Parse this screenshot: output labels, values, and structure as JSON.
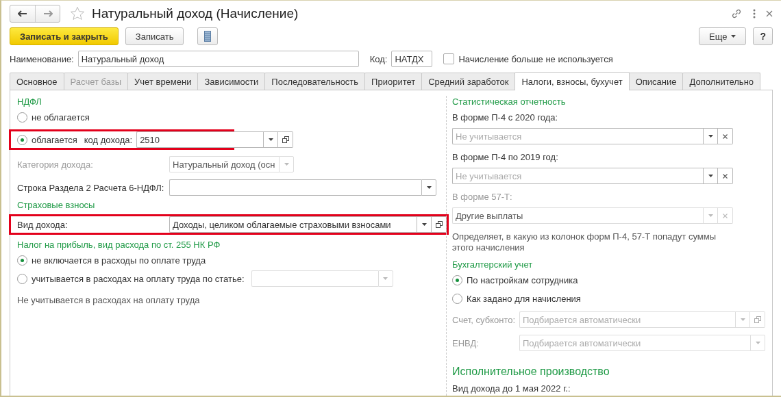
{
  "window": {
    "title": "Натуральный доход (Начисление)"
  },
  "toolbar": {
    "save_close": "Записать и закрыть",
    "save": "Записать",
    "more": "Еще",
    "help": "?"
  },
  "header": {
    "name_label": "Наименование:",
    "name_value": "Натуральный доход",
    "code_label": "Код:",
    "code_value": "НАТДХ",
    "unused": {
      "label": "Начисление больше не используется",
      "checked": false
    }
  },
  "tabs": [
    {
      "label": "Основное",
      "selected": false,
      "disabled": false
    },
    {
      "label": "Расчет базы",
      "selected": false,
      "disabled": true
    },
    {
      "label": "Учет времени",
      "selected": false,
      "disabled": false
    },
    {
      "label": "Зависимости",
      "selected": false,
      "disabled": false
    },
    {
      "label": "Последовательность",
      "selected": false,
      "disabled": false
    },
    {
      "label": "Приоритет",
      "selected": false,
      "disabled": false
    },
    {
      "label": "Средний заработок",
      "selected": false,
      "disabled": false
    },
    {
      "label": "Налоги, взносы, бухучет",
      "selected": true,
      "disabled": false
    },
    {
      "label": "Описание",
      "selected": false,
      "disabled": false
    },
    {
      "label": "Дополнительно",
      "selected": false,
      "disabled": false
    }
  ],
  "left": [
    {
      "kind": "section",
      "text": "НДФЛ"
    },
    {
      "kind": "radio",
      "label": "не облагается",
      "selected": false
    },
    {
      "kind": "radio",
      "label": "облагается",
      "selected": true,
      "highlighted": true,
      "field": {
        "label": "код дохода:",
        "value": "2510",
        "disabled": false,
        "dropdown": true,
        "open_button": true
      }
    },
    {
      "kind": "field",
      "label": "Категория дохода:",
      "value": "Натуральный доход (осн",
      "disabled": true,
      "dropdown": true
    },
    {
      "kind": "field",
      "label": "Строка Раздела 2 Расчета 6-НДФЛ:",
      "disabled": false,
      "dropdown": true
    },
    {
      "kind": "section",
      "text": "Страховые взносы"
    },
    {
      "kind": "field",
      "label": "Вид дохода:",
      "value": "Доходы, целиком облагаемые страховыми взносами",
      "disabled": false,
      "highlighted": true,
      "dropdown": true,
      "open_button": true
    },
    {
      "kind": "section",
      "text": "Налог на прибыль, вид расхода по ст. 255 НК РФ"
    },
    {
      "kind": "radio",
      "label": "не включается в расходы по оплате труда",
      "selected": true
    },
    {
      "kind": "radio",
      "label": "учитывается в расходах на оплату труда по статье:",
      "selected": false,
      "field": {
        "disabled": true,
        "dropdown": true
      }
    },
    {
      "kind": "note",
      "text": "Не учитывается в расходах на оплату труда"
    }
  ],
  "right": [
    {
      "kind": "section",
      "text": "Статистическая отчетность"
    },
    {
      "kind": "label",
      "text": "В форме П-4 с 2020 года:",
      "disabled": false
    },
    {
      "kind": "field",
      "placeholder": "Не учитывается",
      "disabled": false,
      "dropdown": true,
      "clear_button": true
    },
    {
      "kind": "label",
      "text": "В форме П-4 по 2019 год:",
      "disabled": false
    },
    {
      "kind": "field",
      "placeholder": "Не учитывается",
      "disabled": false,
      "dropdown": true,
      "clear_button": true
    },
    {
      "kind": "label",
      "text": "В форме 57-Т:",
      "disabled": true
    },
    {
      "kind": "field",
      "value": "Другие выплаты",
      "disabled": true,
      "dropdown": true,
      "clear_button": true
    },
    {
      "kind": "note",
      "text": "Определяет, в какую из колонок форм П-4, 57-Т попадут суммы этого начисления"
    },
    {
      "kind": "section",
      "text": "Бухгалтерский учет"
    },
    {
      "kind": "radio",
      "label": "По настройкам сотрудника",
      "selected": true
    },
    {
      "kind": "radio",
      "label": "Как задано для начисления",
      "selected": false
    },
    {
      "kind": "field",
      "label": "Счет, субконто:",
      "placeholder": "Подбирается автоматически",
      "disabled": true,
      "dropdown": true,
      "open_button": true
    },
    {
      "kind": "field",
      "label": "ЕНВД:",
      "placeholder": "Подбирается автоматически",
      "disabled": true,
      "dropdown": true
    },
    {
      "kind": "heading",
      "text": "Исполнительное производство"
    },
    {
      "kind": "label",
      "text": "Вид дохода до 1 мая 2022 г.:",
      "disabled": false
    }
  ]
}
